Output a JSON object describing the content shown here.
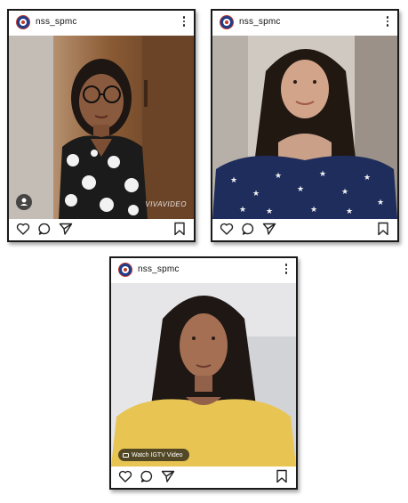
{
  "posts": [
    {
      "username": "nss_spmc",
      "watermark": "VIVAVIDEO",
      "icons": [
        "more-options-icon",
        "user-tag-icon",
        "heart-icon",
        "comment-icon",
        "share-icon",
        "bookmark-icon"
      ]
    },
    {
      "username": "nss_spmc",
      "icons": [
        "more-options-icon",
        "heart-icon",
        "comment-icon",
        "share-icon",
        "bookmark-icon"
      ]
    },
    {
      "username": "nss_spmc",
      "igtv_label": "Watch IGTV Video",
      "icons": [
        "more-options-icon",
        "igtv-icon",
        "heart-icon",
        "comment-icon",
        "share-icon",
        "bookmark-icon"
      ]
    }
  ],
  "colors": {
    "border": "#1a1a1a",
    "avatar_blue": "#1f3c88",
    "avatar_red": "#c0392b",
    "text": "#111111"
  }
}
